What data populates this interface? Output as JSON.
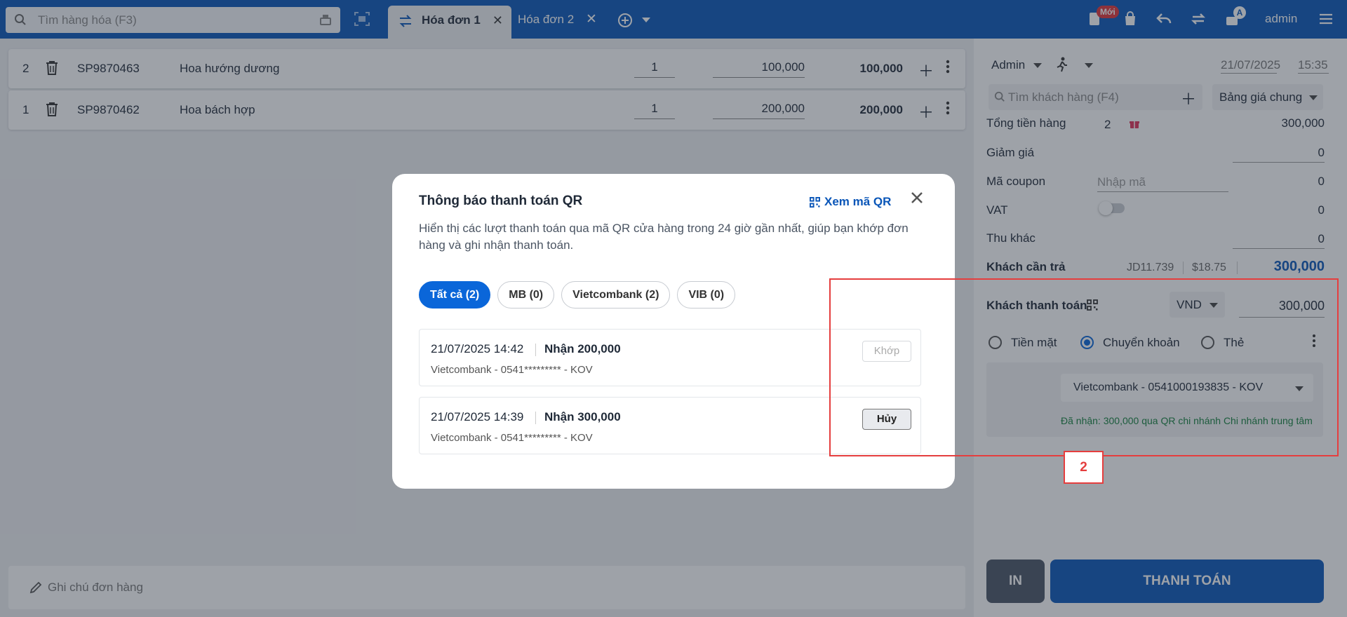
{
  "topbar": {
    "search_placeholder": "Tìm hàng hóa (F3)",
    "tabs": [
      {
        "label": "Hóa đơn 1",
        "active": true
      },
      {
        "label": "Hóa đơn 2",
        "active": false
      }
    ],
    "new_badge": "Mới",
    "notif_badge": "A",
    "user": "admin"
  },
  "cart": {
    "lines": [
      {
        "index": "2",
        "code": "SP9870463",
        "name": "Hoa hướng dương",
        "qty": "1",
        "price": "100,000",
        "total": "100,000"
      },
      {
        "index": "1",
        "code": "SP9870462",
        "name": "Hoa bách hợp",
        "qty": "1",
        "price": "200,000",
        "total": "200,000"
      }
    ],
    "note_placeholder": "Ghi chú đơn hàng"
  },
  "panel": {
    "seller": "Admin",
    "date": "21/07/2025",
    "time": "15:35",
    "customer_placeholder": "Tìm khách hàng (F4)",
    "price_list": "Bảng giá chung",
    "total_goods_label": "Tổng tiền hàng",
    "total_goods_count": "2",
    "total_goods_value": "300,000",
    "discount_label": "Giảm giá",
    "discount_value": "0",
    "coupon_label": "Mã coupon",
    "coupon_placeholder": "Nhập mã",
    "coupon_value": "0",
    "vat_label": "VAT",
    "vat_value": "0",
    "other_label": "Thu khác",
    "other_value": "0",
    "due_label": "Khách cần trả",
    "due_jd": "JD11.739",
    "due_usd": "$18.75",
    "due_value": "300,000",
    "paid_label": "Khách thanh toán",
    "currency": "VND",
    "paid_value": "300,000",
    "methods": [
      "Tiền mặt",
      "Chuyển khoản",
      "Thẻ"
    ],
    "selected_method": "Chuyển khoản",
    "bank_account": "Vietcombank - 0541000193835 - KOV",
    "received_note": "Đã nhận: 300,000 qua QR chi nhánh Chi nhánh trung tâm",
    "print_label": "IN",
    "pay_label": "THANH TOÁN"
  },
  "modal": {
    "title": "Thông báo thanh toán QR",
    "view_qr": "Xem mã QR",
    "description": "Hiển thị các lượt thanh toán qua mã QR cửa hàng trong 24 giờ gần nhất, giúp bạn khớp đơn hàng và ghi nhận thanh toán.",
    "filters": [
      {
        "label": "Tất cả (2)",
        "active": true
      },
      {
        "label": "MB (0)",
        "active": false
      },
      {
        "label": "Vietcombank (2)",
        "active": false
      },
      {
        "label": "VIB (0)",
        "active": false
      }
    ],
    "transactions": [
      {
        "time": "21/07/2025 14:42",
        "amount": "Nhận 200,000",
        "account": "Vietcombank - 0541********* - KOV",
        "action": "Khớp"
      },
      {
        "time": "21/07/2025 14:39",
        "amount": "Nhận 300,000",
        "account": "Vietcombank - 0541********* - KOV",
        "action": "Hủy"
      }
    ]
  },
  "annotation": {
    "label": "2",
    "color": "#e53e3e"
  },
  "colors": {
    "brand": "#0a56b8",
    "accent": "#0a66d9",
    "received": "#15803d",
    "gift": "#e0345a"
  }
}
